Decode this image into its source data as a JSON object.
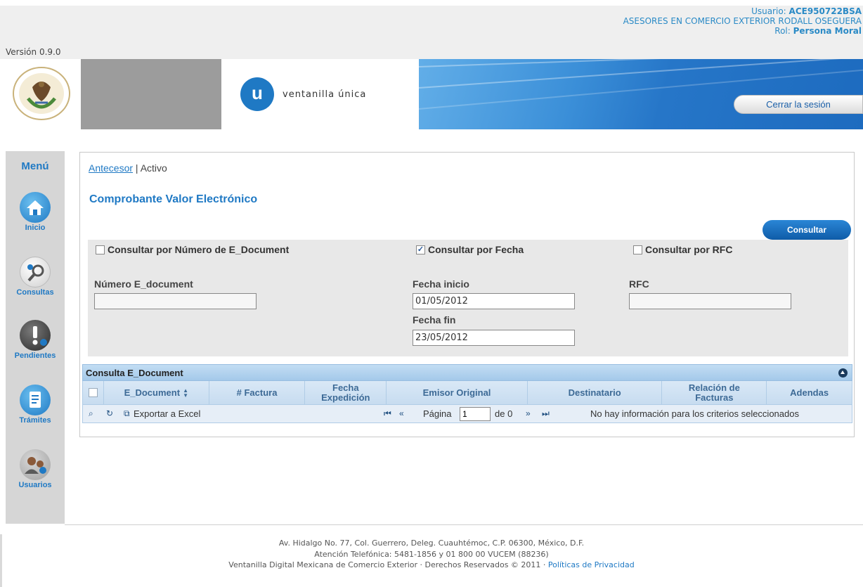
{
  "header": {
    "version": "Versión 0.9.0",
    "user_label": "Usuario: ",
    "user_value": "ACE950722BSA",
    "company": "ASESORES EN COMERCIO EXTERIOR RODALL OSEGUERA",
    "role_label": "Rol: ",
    "role_value": "Persona Moral"
  },
  "banner": {
    "logo_letter": "u",
    "logo_text": "ventanilla única",
    "logout_label": "Cerrar la sesión"
  },
  "sidebar": {
    "title": "Menú",
    "items": [
      {
        "label": "Inicio",
        "icon": "home-icon"
      },
      {
        "label": "Consultas",
        "icon": "search-icon"
      },
      {
        "label": "Pendientes",
        "icon": "alert-icon"
      },
      {
        "label": "Trámites",
        "icon": "document-icon"
      },
      {
        "label": "Usuarios",
        "icon": "users-icon"
      }
    ]
  },
  "breadcrumb": {
    "link": "Antecesor",
    "separator": " | ",
    "current": "Activo"
  },
  "page": {
    "title": "Comprobante Valor Electrónico",
    "consultar_label": "Consultar"
  },
  "filters": {
    "by_number": {
      "label": "Consultar por Número de E_Document",
      "checked": false
    },
    "by_date": {
      "label": "Consultar por Fecha",
      "checked": true
    },
    "by_rfc": {
      "label": "Consultar por RFC",
      "checked": false
    },
    "number_label": "Número E_document",
    "number_value": "",
    "date_start_label": "Fecha inicio",
    "date_start_value": "01/05/2012",
    "date_end_label": "Fecha fin",
    "date_end_value": "23/05/2012",
    "rfc_label": "RFC",
    "rfc_value": ""
  },
  "grid": {
    "title": "Consulta E_Document",
    "columns": [
      "E_Document",
      "# Factura",
      "Fecha\nExpedición",
      "Emisor Original",
      "Destinatario",
      "Relación de\nFacturas",
      "Adendas"
    ],
    "sort_glyph": "▲▼",
    "export_label": "Exportar a Excel",
    "page_label": "Página",
    "page_value": "1",
    "of_label": "de 0",
    "no_data": "No hay información para los criterios seleccionados"
  },
  "footer": {
    "line1": "Av. Hidalgo No. 77, Col. Guerrero, Deleg. Cuauhtémoc, C.P. 06300, México, D.F.",
    "line2": "Atención Telefónica: 5481-1856 y 01 800 00 VUCEM (88236)",
    "line3": "Ventanilla Digital Mexicana de Comercio Exterior · Derechos Reservados © 2011 · ",
    "privacy_link": "Políticas de Privacidad"
  },
  "colors": {
    "accent": "#1f79c4",
    "banner_blue": "#2676c8",
    "sidebar_bg": "#d6d6d6",
    "grid_header": "#a4c9ea"
  }
}
